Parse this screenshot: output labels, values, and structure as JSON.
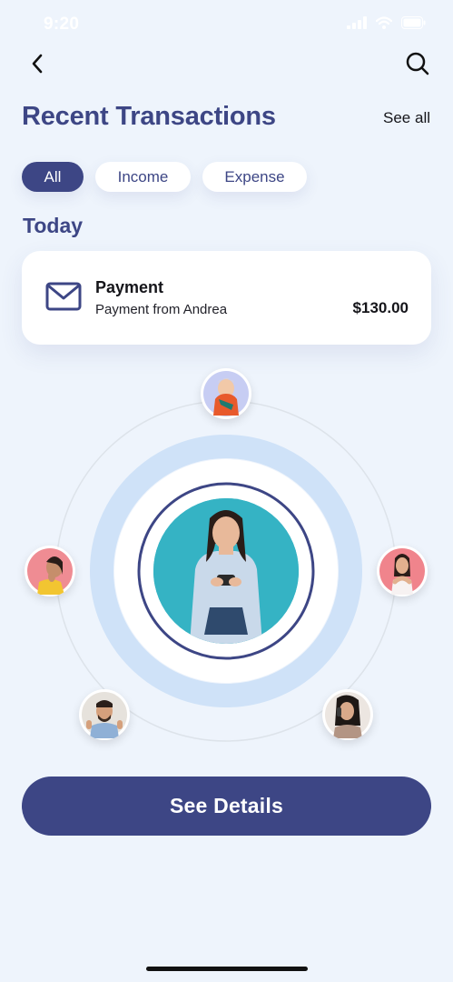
{
  "status_bar": {
    "time": "9:20"
  },
  "header": {
    "title": "Recent Transactions",
    "see_all_label": "See all"
  },
  "filters": [
    {
      "label": "All",
      "active": true
    },
    {
      "label": "Income",
      "active": false
    },
    {
      "label": "Expense",
      "active": false
    }
  ],
  "section_label": "Today",
  "transaction": {
    "icon": "mail-icon",
    "title": "Payment",
    "subtitle": "Payment from Andrea",
    "amount": "$130.00"
  },
  "primary_button_label": "See Details",
  "colors": {
    "primary": "#3d4685",
    "background": "#eef4fc",
    "ring_light": "#cfe2f8",
    "card": "#ffffff"
  }
}
